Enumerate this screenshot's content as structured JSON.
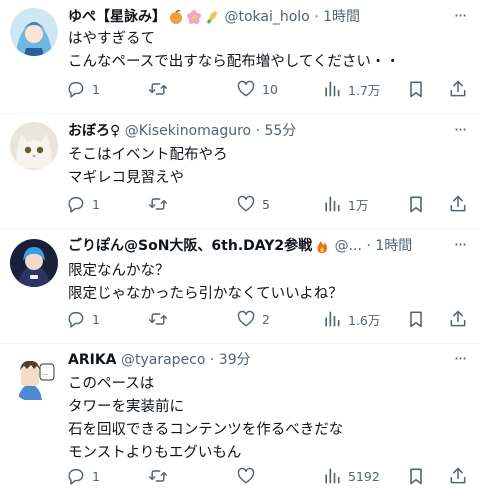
{
  "tweets": [
    {
      "name": "ゆぺ【星詠み】",
      "handle": "@tokai_holo",
      "dot": "·",
      "time": "1時間",
      "lines": [
        "はやすぎるて",
        "こんなペースで出すなら配布増やしてください・・"
      ],
      "replies": "1",
      "retweets": "",
      "likes": "10",
      "views": "1.7万"
    },
    {
      "name": "おぼろ♀",
      "handle": "@Kisekinomaguro",
      "dot": "·",
      "time": "55分",
      "lines": [
        "そこはイベント配布やろ",
        "マギレコ見習えや"
      ],
      "replies": "1",
      "retweets": "",
      "likes": "5",
      "views": "1万"
    },
    {
      "name": "ごりぽん@SoN大阪、6th.DAY2参戦",
      "handle": "@...",
      "dot": "·",
      "time": "1時間",
      "lines": [
        "限定なんかな？",
        "限定じゃなかったら引かなくていいよね？"
      ],
      "replies": "1",
      "retweets": "",
      "likes": "2",
      "views": "1.6万"
    },
    {
      "name": "ARIKA",
      "handle": "@tyarapeco",
      "dot": "·",
      "time": "39分",
      "lines": [
        "このペースは",
        "タワーを実装前に",
        "石を回収できるコンテンツを作るべきだな",
        "モンストよりもエグいもん"
      ],
      "replies": "1",
      "retweets": "",
      "likes": "",
      "views": "5192"
    }
  ],
  "more_label": "···",
  "icons": {
    "reply": "reply-icon",
    "retweet": "retweet-icon",
    "like": "heart-icon",
    "views": "views-icon",
    "bookmark": "bookmark-icon",
    "share": "share-icon",
    "more": "more-icon"
  },
  "colors": {
    "text": "#0f1419",
    "secondary": "#536471",
    "divider": "#eff3f4"
  }
}
